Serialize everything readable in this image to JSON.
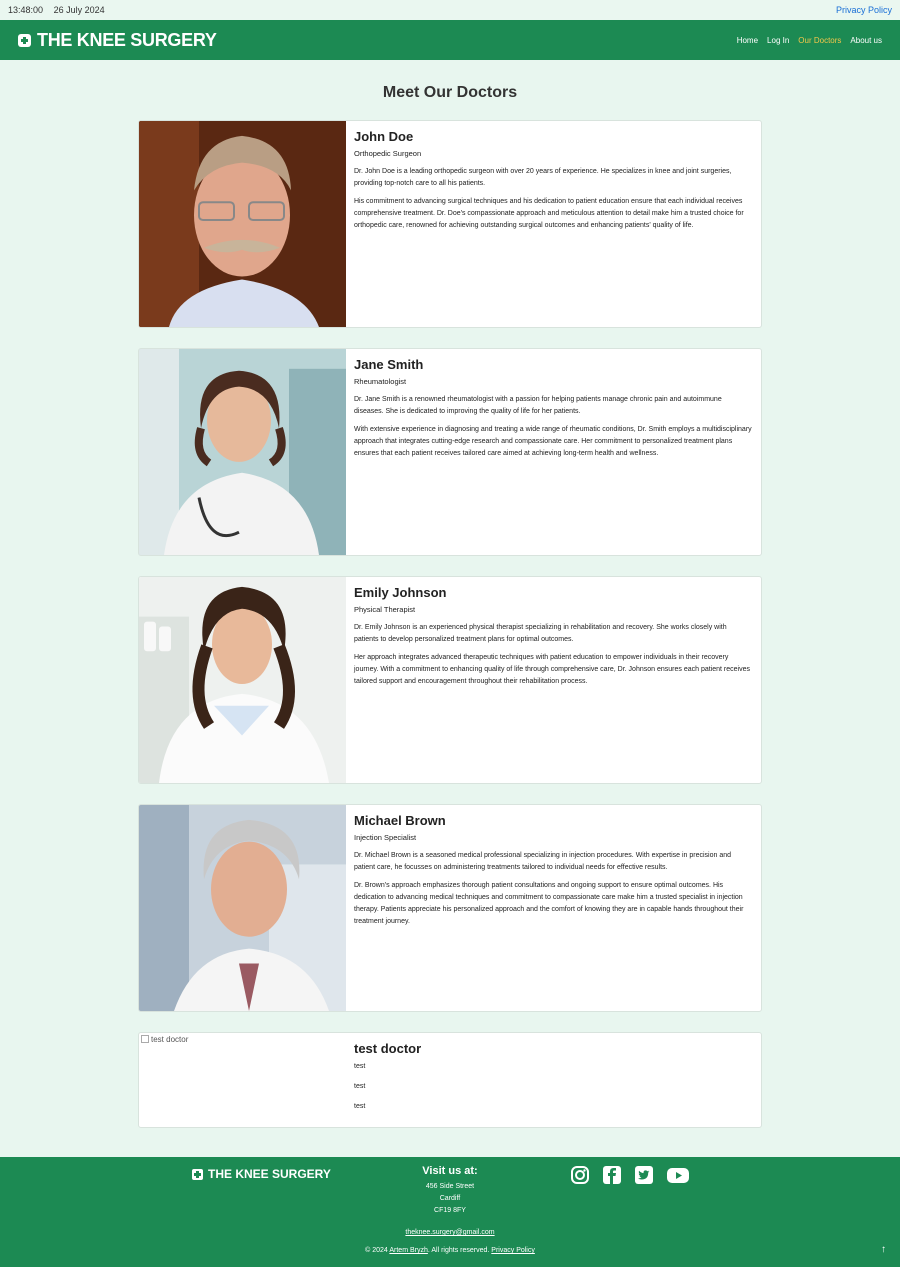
{
  "topbar": {
    "time": "13:48:00",
    "date": "26 July 2024",
    "privacy": "Privacy Policy"
  },
  "navbar": {
    "brand": "THE KNEE SURGERY",
    "links": [
      "Home",
      "Log In",
      "Our Doctors",
      "About us"
    ],
    "active": "Our Doctors"
  },
  "page": {
    "title": "Meet Our Doctors"
  },
  "doctors": [
    {
      "name": "John Doe",
      "role": "Orthopedic Surgeon",
      "p1": "Dr. John Doe is a leading orthopedic surgeon with over 20 years of experience. He specializes in knee and joint surgeries, providing top-notch care to all his patients.",
      "p2": "His commitment to advancing surgical techniques and his dedication to patient education ensure that each individual receives comprehensive treatment. Dr. Doe's compassionate approach and meticulous attention to detail make him a trusted choice for orthopedic care, renowned for achieving outstanding surgical outcomes and enhancing patients' quality of life."
    },
    {
      "name": "Jane Smith",
      "role": "Rheumatologist",
      "p1": "Dr. Jane Smith is a renowned rheumatologist with a passion for helping patients manage chronic pain and autoimmune diseases. She is dedicated to improving the quality of life for her patients.",
      "p2": "With extensive experience in diagnosing and treating a wide range of rheumatic conditions, Dr. Smith employs a multidisciplinary approach that integrates cutting-edge research and compassionate care. Her commitment to personalized treatment plans ensures that each patient receives tailored care aimed at achieving long-term health and wellness."
    },
    {
      "name": "Emily Johnson",
      "role": "Physical Therapist",
      "p1": "Dr. Emily Johnson is an experienced physical therapist specializing in rehabilitation and recovery. She works closely with patients to develop personalized treatment plans for optimal outcomes.",
      "p2": "Her approach integrates advanced therapeutic techniques with patient education to empower individuals in their recovery journey. With a commitment to enhancing quality of life through comprehensive care, Dr. Johnson ensures each patient receives tailored support and encouragement throughout their rehabilitation process."
    },
    {
      "name": "Michael Brown",
      "role": "Injection Specialist",
      "p1": "Dr. Michael Brown is a seasoned medical professional specializing in injection procedures. With expertise in precision and patient care, he focusses on administering treatments tailored to individual needs for effective results.",
      "p2": "Dr. Brown's approach emphasizes thorough patient consultations and ongoing support to ensure optimal outcomes. His dedication to advancing medical techniques and commitment to compassionate care make him a trusted specialist in injection therapy. Patients appreciate his personalized approach and the comfort of knowing they are in capable hands throughout their treatment journey."
    }
  ],
  "test_doctor": {
    "alt": "test doctor",
    "name": "test doctor",
    "lines": [
      "test",
      "test",
      "test"
    ]
  },
  "footer": {
    "brand": "THE KNEE SURGERY",
    "visit_title": "Visit us at:",
    "address": [
      "456 Side Street",
      "Cardiff",
      "CF19 8FY"
    ],
    "email": "theknee.surgery@gmail.com",
    "copy_prefix": "© 2024",
    "author": "Artem Bryzh",
    "copy_mid": ". All rights reserved.",
    "privacy": "Privacy Policy",
    "socials": [
      "instagram-icon",
      "facebook-icon",
      "twitter-icon",
      "youtube-icon"
    ]
  },
  "colors": {
    "brand_green": "#1c8a53",
    "active_link": "#f3c64a",
    "background": "#e8f6ef"
  }
}
